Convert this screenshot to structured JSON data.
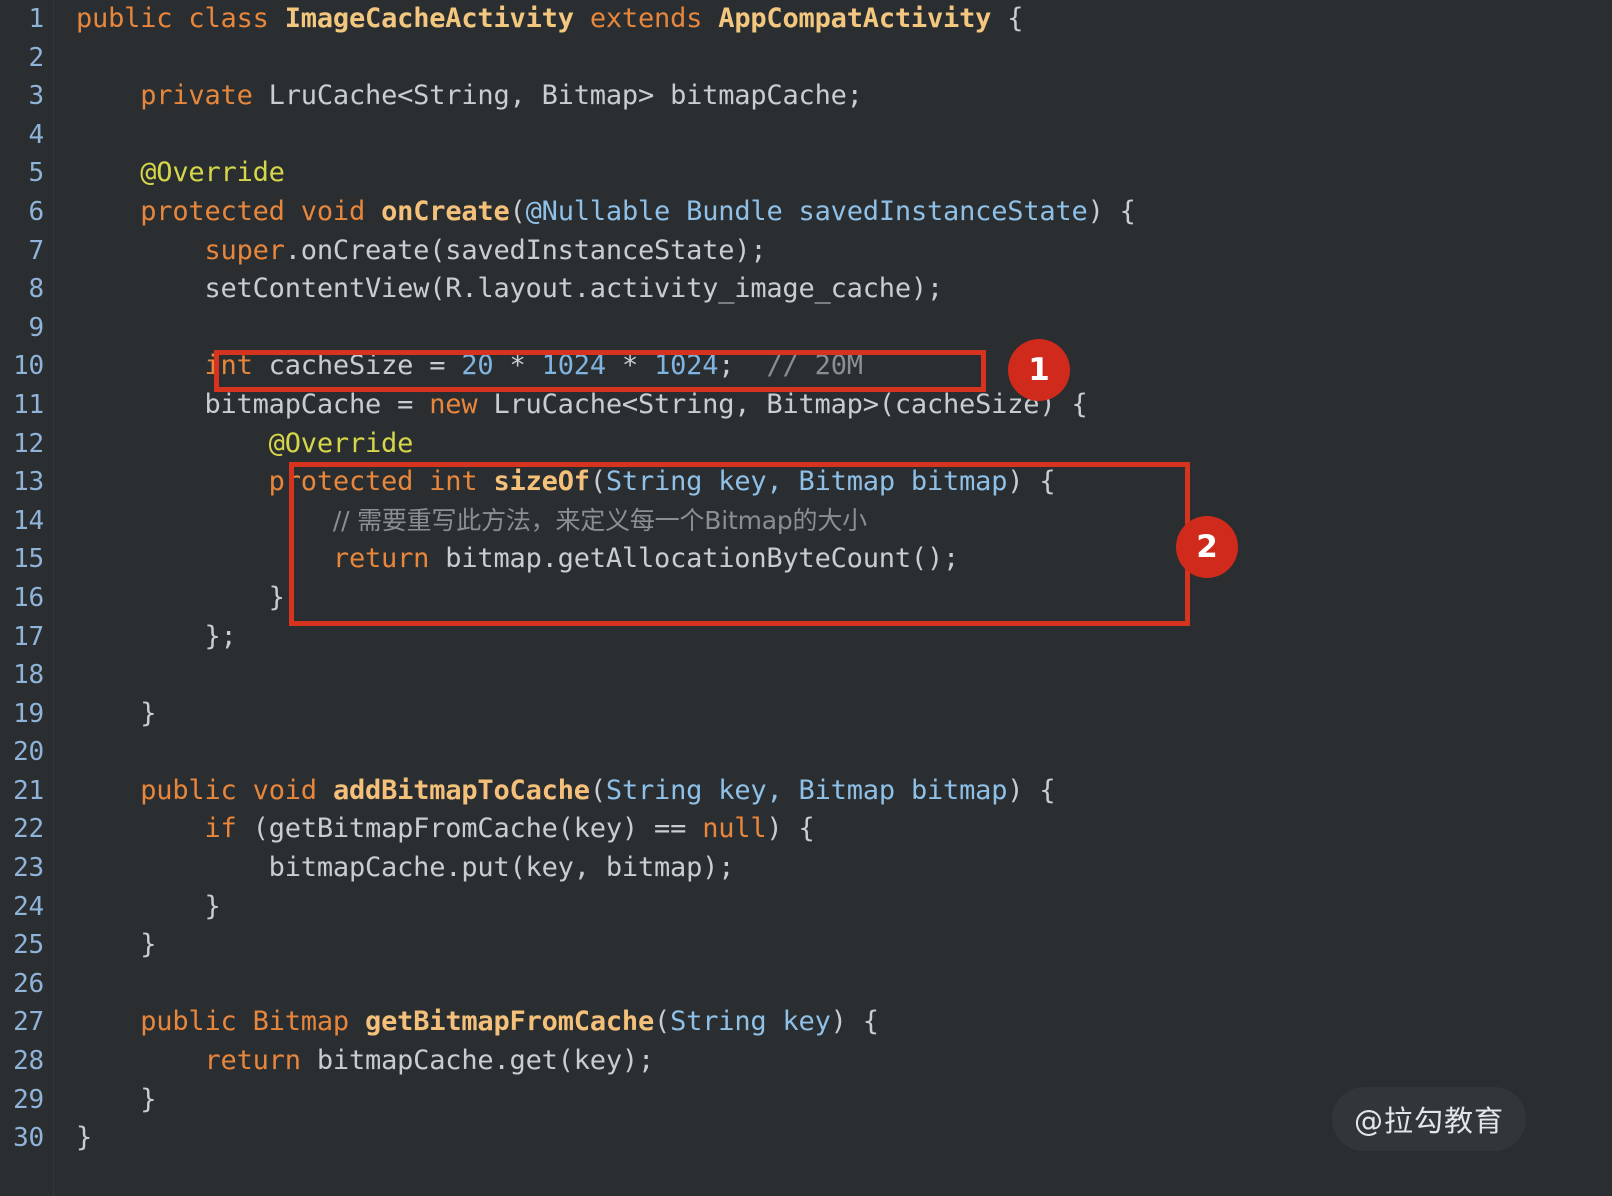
{
  "editor": {
    "language": "Java",
    "theme": "dark",
    "background_color": "#2a2e30",
    "line_number_color": "#8fb3d9",
    "first_line": 1,
    "last_line": 30,
    "line_numbers": [
      "1",
      "2",
      "3",
      "4",
      "5",
      "6",
      "7",
      "8",
      "9",
      "10",
      "11",
      "12",
      "13",
      "14",
      "15",
      "16",
      "17",
      "18",
      "19",
      "20",
      "21",
      "22",
      "23",
      "24",
      "25",
      "26",
      "27",
      "28",
      "29",
      "30"
    ]
  },
  "colors": {
    "keyword": "#e8863c",
    "type_declaration": "#f4c77f",
    "method_declaration": "#f4c07a",
    "annotation": "#d6d64a",
    "parameter_type": "#8fc0e8",
    "number": "#7fb4e0",
    "comment": "#8a8f91",
    "plain": "#c8cdd2",
    "highlight_red": "#d7341f",
    "badge_red": "#cf2a1c"
  },
  "code": {
    "lines": [
      {
        "n": "1",
        "tokens": [
          {
            "t": "public",
            "c": "kw"
          },
          {
            "t": " ",
            "c": "pln"
          },
          {
            "t": "class",
            "c": "kw"
          },
          {
            "t": " ",
            "c": "pln"
          },
          {
            "t": "ImageCacheActivity",
            "c": "typ"
          },
          {
            "t": " ",
            "c": "pln"
          },
          {
            "t": "extends",
            "c": "kw"
          },
          {
            "t": " ",
            "c": "pln"
          },
          {
            "t": "AppCompatActivity",
            "c": "typ"
          },
          {
            "t": " {",
            "c": "pln"
          }
        ]
      },
      {
        "n": "2",
        "tokens": []
      },
      {
        "n": "3",
        "tokens": [
          {
            "t": "    ",
            "c": "pln"
          },
          {
            "t": "private",
            "c": "kw"
          },
          {
            "t": " LruCache<String, Bitmap> bitmapCache;",
            "c": "pln"
          }
        ]
      },
      {
        "n": "4",
        "tokens": []
      },
      {
        "n": "5",
        "tokens": [
          {
            "t": "    ",
            "c": "pln"
          },
          {
            "t": "@Override",
            "c": "ann"
          }
        ]
      },
      {
        "n": "6",
        "tokens": [
          {
            "t": "    ",
            "c": "pln"
          },
          {
            "t": "protected",
            "c": "kw"
          },
          {
            "t": " ",
            "c": "pln"
          },
          {
            "t": "void",
            "c": "kw"
          },
          {
            "t": " ",
            "c": "pln"
          },
          {
            "t": "onCreate",
            "c": "mth"
          },
          {
            "t": "(",
            "c": "pln"
          },
          {
            "t": "@Nullable Bundle savedInstanceState",
            "c": "par"
          },
          {
            "t": ") {",
            "c": "pln"
          }
        ]
      },
      {
        "n": "7",
        "tokens": [
          {
            "t": "        ",
            "c": "pln"
          },
          {
            "t": "super",
            "c": "kw"
          },
          {
            "t": ".onCreate(savedInstanceState);",
            "c": "pln"
          }
        ]
      },
      {
        "n": "8",
        "tokens": [
          {
            "t": "        setContentView(R.layout.activity_image_cache);",
            "c": "pln"
          }
        ]
      },
      {
        "n": "9",
        "tokens": []
      },
      {
        "n": "10",
        "tokens": [
          {
            "t": "        ",
            "c": "pln"
          },
          {
            "t": "int",
            "c": "kw"
          },
          {
            "t": " cacheSize = ",
            "c": "pln"
          },
          {
            "t": "20",
            "c": "num"
          },
          {
            "t": " * ",
            "c": "pln"
          },
          {
            "t": "1024",
            "c": "num"
          },
          {
            "t": " * ",
            "c": "pln"
          },
          {
            "t": "1024",
            "c": "num"
          },
          {
            "t": ";  ",
            "c": "pln"
          },
          {
            "t": "// 20M",
            "c": "cmt"
          }
        ]
      },
      {
        "n": "11",
        "tokens": [
          {
            "t": "        bitmapCache = ",
            "c": "pln"
          },
          {
            "t": "new",
            "c": "kw"
          },
          {
            "t": " LruCache<String, Bitmap>(cacheSize) {",
            "c": "pln"
          }
        ]
      },
      {
        "n": "12",
        "tokens": [
          {
            "t": "            ",
            "c": "pln"
          },
          {
            "t": "@Override",
            "c": "ann"
          }
        ]
      },
      {
        "n": "13",
        "tokens": [
          {
            "t": "            ",
            "c": "pln"
          },
          {
            "t": "protected",
            "c": "kw"
          },
          {
            "t": " ",
            "c": "pln"
          },
          {
            "t": "int",
            "c": "kw"
          },
          {
            "t": " ",
            "c": "pln"
          },
          {
            "t": "sizeOf",
            "c": "mth"
          },
          {
            "t": "(",
            "c": "pln"
          },
          {
            "t": "String key, Bitmap bitmap",
            "c": "par"
          },
          {
            "t": ") {",
            "c": "pln"
          }
        ]
      },
      {
        "n": "14",
        "tokens": [
          {
            "t": "                ",
            "c": "pln"
          },
          {
            "t": "// 需要重写此方法，来定义每一个Bitmap的大小",
            "c": "cmt-cn"
          }
        ]
      },
      {
        "n": "15",
        "tokens": [
          {
            "t": "                ",
            "c": "pln"
          },
          {
            "t": "return",
            "c": "kw"
          },
          {
            "t": " bitmap.getAllocationByteCount();",
            "c": "pln"
          }
        ]
      },
      {
        "n": "16",
        "tokens": [
          {
            "t": "            }",
            "c": "pln"
          }
        ]
      },
      {
        "n": "17",
        "tokens": [
          {
            "t": "        };",
            "c": "pln"
          }
        ]
      },
      {
        "n": "18",
        "tokens": []
      },
      {
        "n": "19",
        "tokens": [
          {
            "t": "    }",
            "c": "pln"
          }
        ]
      },
      {
        "n": "20",
        "tokens": []
      },
      {
        "n": "21",
        "tokens": [
          {
            "t": "    ",
            "c": "pln"
          },
          {
            "t": "public",
            "c": "kw"
          },
          {
            "t": " ",
            "c": "pln"
          },
          {
            "t": "void",
            "c": "kw"
          },
          {
            "t": " ",
            "c": "pln"
          },
          {
            "t": "addBitmapToCache",
            "c": "mth"
          },
          {
            "t": "(",
            "c": "pln"
          },
          {
            "t": "String key, Bitmap bitmap",
            "c": "par"
          },
          {
            "t": ") {",
            "c": "pln"
          }
        ]
      },
      {
        "n": "22",
        "tokens": [
          {
            "t": "        ",
            "c": "pln"
          },
          {
            "t": "if",
            "c": "kw"
          },
          {
            "t": " (getBitmapFromCache(key) == ",
            "c": "pln"
          },
          {
            "t": "null",
            "c": "kw"
          },
          {
            "t": ") {",
            "c": "pln"
          }
        ]
      },
      {
        "n": "23",
        "tokens": [
          {
            "t": "            bitmapCache.put(key, bitmap);",
            "c": "pln"
          }
        ]
      },
      {
        "n": "24",
        "tokens": [
          {
            "t": "        }",
            "c": "pln"
          }
        ]
      },
      {
        "n": "25",
        "tokens": [
          {
            "t": "    }",
            "c": "pln"
          }
        ]
      },
      {
        "n": "26",
        "tokens": []
      },
      {
        "n": "27",
        "tokens": [
          {
            "t": "    ",
            "c": "pln"
          },
          {
            "t": "public",
            "c": "kw"
          },
          {
            "t": " ",
            "c": "pln"
          },
          {
            "t": "Bitmap",
            "c": "kw"
          },
          {
            "t": " ",
            "c": "pln"
          },
          {
            "t": "getBitmapFromCache",
            "c": "mth"
          },
          {
            "t": "(",
            "c": "pln"
          },
          {
            "t": "String key",
            "c": "par"
          },
          {
            "t": ") {",
            "c": "pln"
          }
        ]
      },
      {
        "n": "28",
        "tokens": [
          {
            "t": "        ",
            "c": "pln"
          },
          {
            "t": "return",
            "c": "kw"
          },
          {
            "t": " bitmapCache.get(key);",
            "c": "pln"
          }
        ]
      },
      {
        "n": "29",
        "tokens": [
          {
            "t": "    }",
            "c": "pln"
          }
        ]
      },
      {
        "n": "30",
        "tokens": [
          {
            "t": "}",
            "c": "pln"
          }
        ]
      }
    ]
  },
  "annotations": {
    "boxes": [
      {
        "id": "1",
        "target_line": "10",
        "label": "1"
      },
      {
        "id": "2",
        "target_lines": "13-16",
        "label": "2"
      }
    ],
    "badge_1_label": "1",
    "badge_2_label": "2"
  },
  "watermark": {
    "text": "@拉勾教育"
  }
}
